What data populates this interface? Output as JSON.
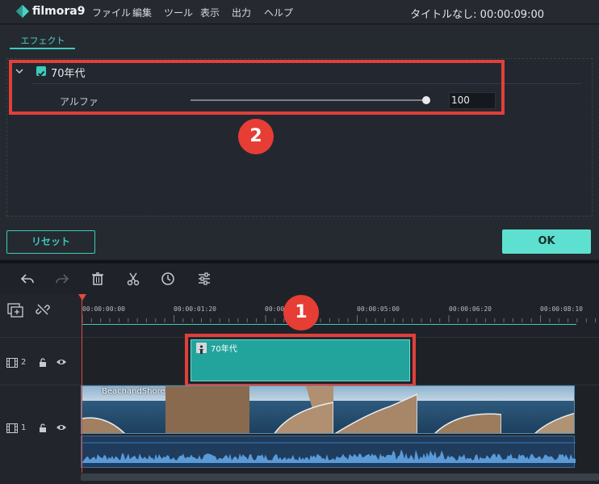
{
  "app": {
    "name": "filmora9",
    "project_title": "タイトルなし:  00:00:09:00"
  },
  "menu": {
    "items": [
      "ファイル",
      "編集",
      "ツール",
      "表示",
      "出力",
      "ヘルプ"
    ]
  },
  "effect_panel": {
    "tab_label": "エフェクト",
    "effect_name": "70年代",
    "param_label": "アルファ",
    "param_value": "100",
    "slider_value_percent": 100
  },
  "buttons": {
    "reset": "リセット",
    "ok": "OK"
  },
  "annotations": {
    "badge1": "1",
    "badge2": "2"
  },
  "timeline": {
    "ticks": [
      "00:00:00:00",
      "00:00:01:20",
      "00:00:03:10",
      "00:00:05:00",
      "00:00:06:20",
      "00:00:08:10"
    ],
    "tracks": [
      {
        "number": "2",
        "clip_name": "70年代"
      },
      {
        "number": "1",
        "clip_name": "BeachandShore"
      }
    ]
  },
  "colors": {
    "accent": "#3ec9bb",
    "highlight": "#e0403a",
    "effect_clip": "#22a49c"
  }
}
